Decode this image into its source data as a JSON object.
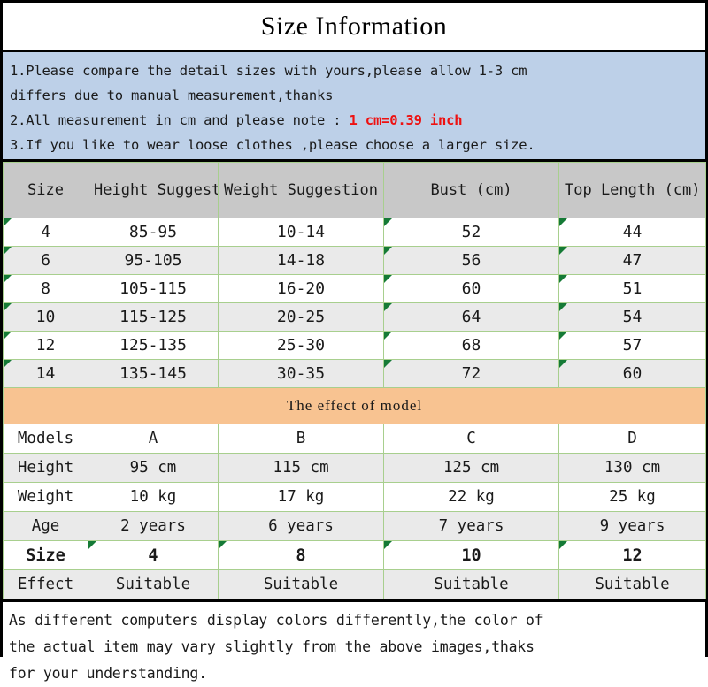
{
  "title": "Size Information",
  "notice": {
    "line1a": "1.Please compare the detail sizes with yours,please allow 1-3 cm",
    "line1b": "differs due to manual measurement,thanks",
    "line2_prefix": "2.All measurement in cm and please note : ",
    "line2_highlight": "1 cm=0.39 inch",
    "line3": "3.If you like to wear loose clothes ,please choose a larger size."
  },
  "size_table": {
    "headers": {
      "size": "Size",
      "height": "Height Suggestion(cm)",
      "height_visible": "Height Suggestion(cm)",
      "weight": "Weight Suggestion(kg)",
      "bust": "Bust (cm)",
      "top_length": "Top Length (cm)"
    },
    "rows": [
      {
        "size": "4",
        "height": "85-95",
        "weight": "10-14",
        "bust": "52",
        "top_length": "44"
      },
      {
        "size": "6",
        "height": "95-105",
        "weight": "14-18",
        "bust": "56",
        "top_length": "47"
      },
      {
        "size": "8",
        "height": "105-115",
        "weight": "16-20",
        "bust": "60",
        "top_length": "51"
      },
      {
        "size": "10",
        "height": "115-125",
        "weight": "20-25",
        "bust": "64",
        "top_length": "54"
      },
      {
        "size": "12",
        "height": "125-135",
        "weight": "25-30",
        "bust": "68",
        "top_length": "57"
      },
      {
        "size": "14",
        "height": "135-145",
        "weight": "30-35",
        "bust": "72",
        "top_length": "60"
      }
    ]
  },
  "model_section": {
    "banner": "The effect of model",
    "labels": {
      "models": "Models",
      "height": "Height",
      "weight": "Weight",
      "age": "Age",
      "size": "Size",
      "effect": "Effect"
    },
    "columns": [
      {
        "model": "A",
        "height": "95 cm",
        "weight": "10 kg",
        "age": "2 years",
        "size": "4",
        "effect": "Suitable"
      },
      {
        "model": "B",
        "height": "115 cm",
        "weight": "17 kg",
        "age": "6 years",
        "size": "8",
        "effect": "Suitable"
      },
      {
        "model": "C",
        "height": "125 cm",
        "weight": "22 kg",
        "age": "7 years",
        "size": "10",
        "effect": "Suitable"
      },
      {
        "model": "D",
        "height": "130 cm",
        "weight": "25 kg",
        "age": "9 years",
        "size": "12",
        "effect": "Suitable"
      }
    ]
  },
  "footer": {
    "line1": "As different computers display colors differently,the color of",
    "line2": "the actual item may vary slightly from the above images,thaks",
    "line3": "for your understanding."
  },
  "colors": {
    "notice_background": "#bdd0e8",
    "header_background": "#c8c8c8",
    "banner_background": "#f8c391",
    "alt_row_background": "#eaeaea",
    "gridline": "#a8cf8e",
    "highlight_text": "#ee1111",
    "corner_marker": "#157a36"
  }
}
